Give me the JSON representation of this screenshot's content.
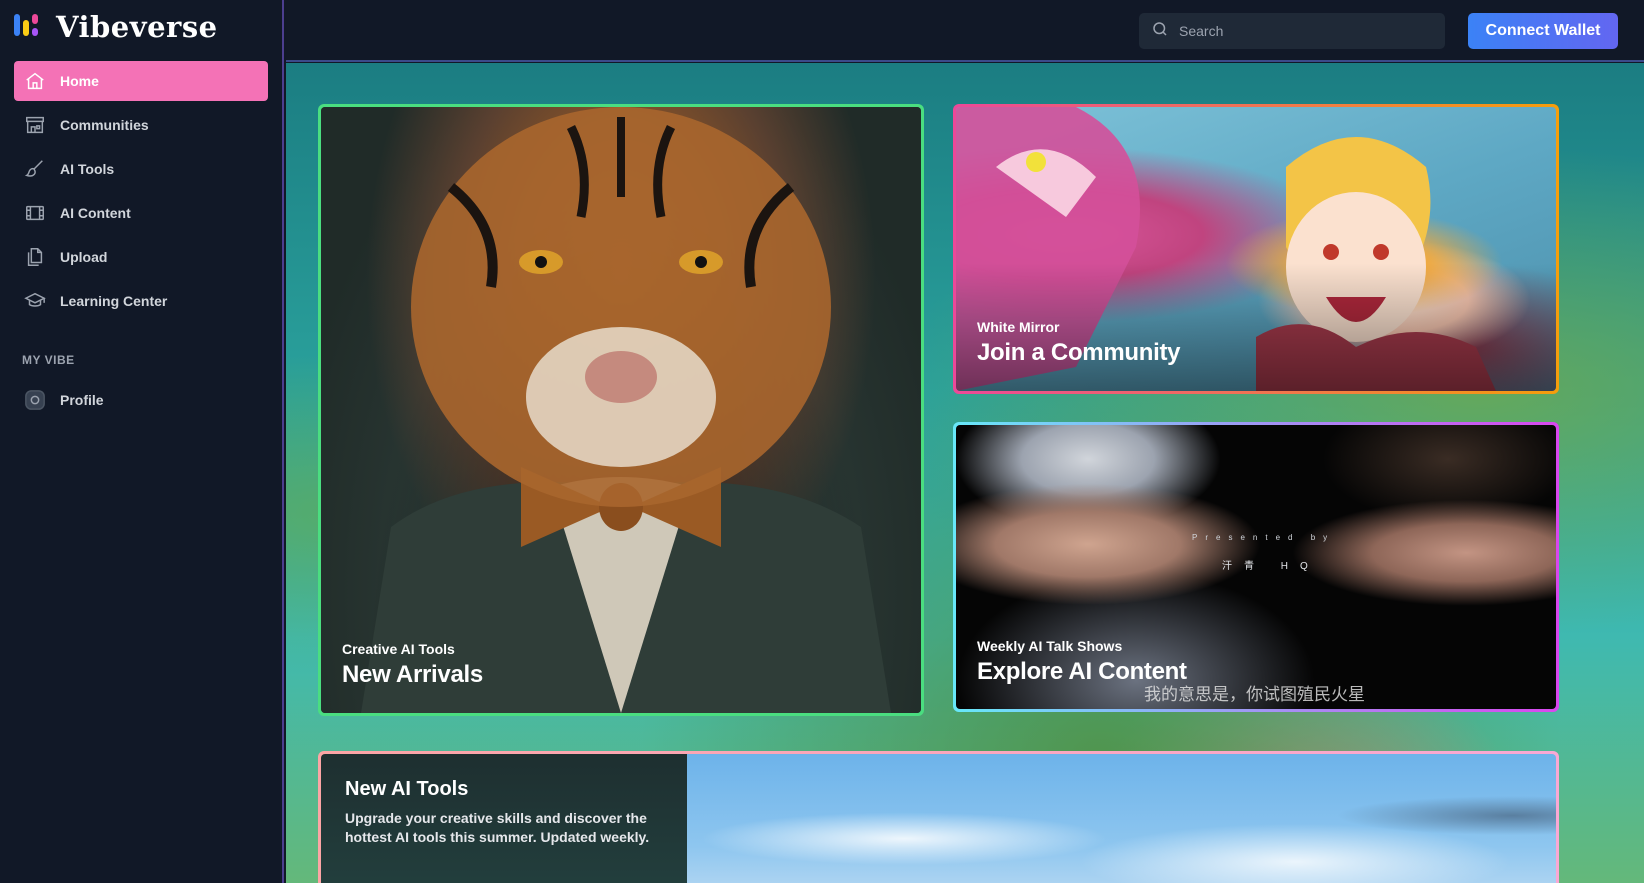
{
  "app": {
    "name": "Vibeverse"
  },
  "sidebar": {
    "items": [
      {
        "label": "Home",
        "icon": "home-icon",
        "active": true
      },
      {
        "label": "Communities",
        "icon": "storefront-icon"
      },
      {
        "label": "AI Tools",
        "icon": "paintbrush-icon"
      },
      {
        "label": "AI Content",
        "icon": "film-icon"
      },
      {
        "label": "Upload",
        "icon": "document-copy-icon"
      },
      {
        "label": "Learning Center",
        "icon": "graduation-cap-icon"
      }
    ],
    "section_title": "MY VIBE",
    "my_vibe_items": [
      {
        "label": "Profile",
        "icon": "profile-icon"
      }
    ]
  },
  "header": {
    "search_placeholder": "Search",
    "connect_label": "Connect Wallet"
  },
  "cards": {
    "tiger": {
      "subtitle": "Creative AI Tools",
      "title": "New Arrivals"
    },
    "anime": {
      "subtitle": "White Mirror",
      "title": "Join a Community"
    },
    "talk": {
      "subtitle": "Weekly AI Talk Shows",
      "title": "Explore AI Content",
      "overlay_presented": "Presented by",
      "overlay_brand": "汗青 HQ",
      "overlay_caption": "我的意思是，你试图殖民火星"
    },
    "tools": {
      "title": "New AI Tools",
      "description": "Upgrade your creative skills and discover the hottest AI tools this summer. Updated weekly."
    }
  },
  "colors": {
    "accent_pink": "#f472b6",
    "sidebar_bg": "#111827",
    "button_gradient_start": "#3b82f6",
    "button_gradient_end": "#6366f1"
  }
}
